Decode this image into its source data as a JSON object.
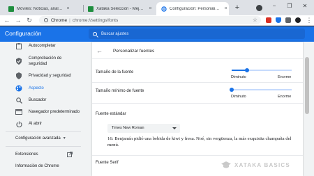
{
  "browser": {
    "tabs": [
      {
        "title": "Móviles: Noticias, análisis y no",
        "close": "×"
      },
      {
        "title": "Xataka Selección - Mejores of",
        "close": "×"
      },
      {
        "title": "Configuración: Personalizar fu",
        "close": "×"
      }
    ],
    "new_tab": "+",
    "window_controls": {
      "minimize": "−",
      "maximize": "❐",
      "close": "✕"
    }
  },
  "toolbar": {
    "back": "←",
    "forward": "→",
    "reload": "↻",
    "site_name": "Chrome",
    "separator": "|",
    "url": "chrome://settings/fonts",
    "star": "☆",
    "menu": "⋮"
  },
  "header": {
    "title": "Configuración",
    "search_placeholder": "Buscar ajustes"
  },
  "sidebar": {
    "items": [
      {
        "label": "Autocompletar",
        "icon": "clipboard-icon"
      },
      {
        "label": "Comprobación de seguridad",
        "icon": "shield-check-icon"
      },
      {
        "label": "Privacidad y seguridad",
        "icon": "shield-icon"
      },
      {
        "label": "Aspecto",
        "icon": "palette-icon",
        "active": true
      },
      {
        "label": "Buscador",
        "icon": "search-icon"
      },
      {
        "label": "Navegador predeterminado",
        "icon": "browser-icon"
      },
      {
        "label": "Al abrir",
        "icon": "power-icon"
      }
    ],
    "advanced": "Configuración avanzada",
    "advanced_arrow": "▾",
    "extensions": "Extensiones",
    "about": "Información de Chrome"
  },
  "main": {
    "back": "←",
    "heading": "Personalizar fuentes",
    "font_size": {
      "label": "Tamaño de la fuente",
      "min_label": "Diminuto",
      "max_label": "Enorme",
      "value_fraction": 0.25
    },
    "min_font_size": {
      "label": "Tamaño mínimo de fuente",
      "min_label": "Diminuto",
      "max_label": "Enorme",
      "value_fraction": 0.0
    },
    "standard_font": {
      "label": "Fuente estándar",
      "selected": "Times New Roman",
      "sample": "16: Benjamín pidió una bebida de kiwi y fresa. Noé, sin vergüenza, la más exquisita champaña del menú."
    },
    "serif_font": {
      "label": "Fuente Serif"
    }
  },
  "watermark": {
    "text": "XATAKA BASICS"
  },
  "colors": {
    "accent": "#1a73e8",
    "header_bg": "#1a73e8",
    "sidebar_bg": "#f1f3f4"
  }
}
